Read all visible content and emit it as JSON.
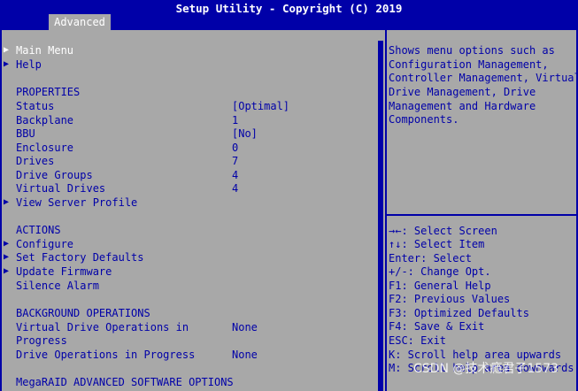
{
  "header": {
    "title": "Setup Utility - Copyright (C) 2019"
  },
  "tabs": [
    {
      "label": "Advanced",
      "active": true
    }
  ],
  "menu": {
    "main_menu": "Main Menu",
    "help": "Help",
    "properties_heading": "PROPERTIES",
    "properties": [
      {
        "label": "Status",
        "value": "[Optimal]"
      },
      {
        "label": "Backplane",
        "value": "1"
      },
      {
        "label": "BBU",
        "value": "[No]"
      },
      {
        "label": "Enclosure",
        "value": "0"
      },
      {
        "label": "Drives",
        "value": "7"
      },
      {
        "label": "Drive Groups",
        "value": "4"
      },
      {
        "label": "Virtual Drives",
        "value": "4"
      }
    ],
    "view_server_profile": "View Server Profile",
    "actions_heading": "ACTIONS",
    "actions": [
      {
        "label": "Configure"
      },
      {
        "label": "Set Factory Defaults"
      },
      {
        "label": "Update Firmware"
      },
      {
        "label": "Silence Alarm"
      }
    ],
    "background_heading": "BACKGROUND OPERATIONS",
    "background": [
      {
        "label_line1": "Virtual Drive Operations in",
        "label_line2": "Progress",
        "value": "None"
      },
      {
        "label": "Drive Operations in Progress",
        "value": "None"
      }
    ],
    "megaraid_heading": "MegaRAID ADVANCED SOFTWARE OPTIONS"
  },
  "help_text": [
    "Shows menu options such as",
    "Configuration Management,",
    "Controller Management, Virtual",
    "Drive Management, Drive",
    "Management and Hardware",
    "Components."
  ],
  "key_help": [
    "→←: Select Screen",
    "↑↓: Select Item",
    "Enter: Select",
    "+/-: Change Opt.",
    "F1: General Help",
    "F2: Previous Values",
    "F3: Optimized Defaults",
    "F4: Save & Exit",
    "ESC: Exit",
    "K: Scroll help area upwards",
    "M: Scroll help area downwards"
  ],
  "watermark": "CSDN @技术瘾君子1573",
  "colors": {
    "bios_blue": "#0000a8",
    "panel_gray": "#a8a8a8",
    "selected_white": "#ffffff"
  }
}
